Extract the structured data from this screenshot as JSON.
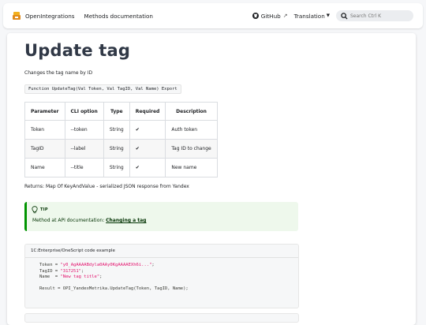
{
  "navbar": {
    "brand": "OpenIntegrations",
    "methods_link": "Methods documentation",
    "github": "GitHub",
    "translation": "Translation",
    "search_placeholder": "Search Ctrl K"
  },
  "page": {
    "title": "Update tag",
    "description": "Changes the tag name by ID",
    "signature": "Function UpdateTag(Val Token, Val TagID, Val Name) Export",
    "returns": "Returns: Map Of KeyAndValue - serialized JSON response from Yandex"
  },
  "table": {
    "headers": [
      "Parameter",
      "CLI option",
      "Type",
      "Required",
      "Description"
    ],
    "rows": [
      [
        "Token",
        "--token",
        "String",
        "✔",
        "Auth token"
      ],
      [
        "TagID",
        "--label",
        "String",
        "✔",
        "Tag ID to change"
      ],
      [
        "Name",
        "--title",
        "String",
        "✔",
        "New name"
      ]
    ]
  },
  "tip": {
    "title": "TIP",
    "text": "Method at API documentation: ",
    "link": "Changing a tag"
  },
  "code": {
    "title": "1C:Enterprise/OneScript code example",
    "l1_a": "Token = ",
    "l1_s": "\"y0_AgAAAABdyla0AAy0KgAAAAEXh6i...\"",
    "l1_c": ";",
    "l2_a": "TagID = ",
    "l2_s": "\"317251\"",
    "l2_c": ";",
    "l3_a": "Name  = ",
    "l3_s": "\"New tag title\"",
    "l3_c": ";",
    "l5": "Result = OPI_YandexMetrika.UpdateTag(Token, TagID, Name);"
  },
  "colors": {
    "tip_border": "#009400",
    "tip_bg": "#eef8ec",
    "string": "#e3116c"
  },
  "icons": {
    "logo": "openintegrations-logo",
    "github": "github-icon",
    "search": "search-icon",
    "tip": "lightbulb-icon"
  }
}
